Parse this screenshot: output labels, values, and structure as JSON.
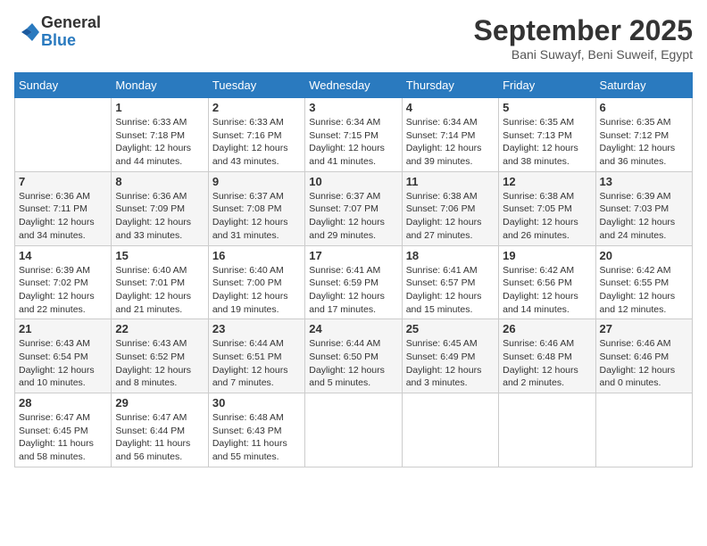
{
  "header": {
    "logo_general": "General",
    "logo_blue": "Blue",
    "month_title": "September 2025",
    "location": "Bani Suwayf, Beni Suweif, Egypt"
  },
  "weekdays": [
    "Sunday",
    "Monday",
    "Tuesday",
    "Wednesday",
    "Thursday",
    "Friday",
    "Saturday"
  ],
  "weeks": [
    [
      {
        "day": "",
        "info": ""
      },
      {
        "day": "1",
        "info": "Sunrise: 6:33 AM\nSunset: 7:18 PM\nDaylight: 12 hours and 44 minutes."
      },
      {
        "day": "2",
        "info": "Sunrise: 6:33 AM\nSunset: 7:16 PM\nDaylight: 12 hours and 43 minutes."
      },
      {
        "day": "3",
        "info": "Sunrise: 6:34 AM\nSunset: 7:15 PM\nDaylight: 12 hours and 41 minutes."
      },
      {
        "day": "4",
        "info": "Sunrise: 6:34 AM\nSunset: 7:14 PM\nDaylight: 12 hours and 39 minutes."
      },
      {
        "day": "5",
        "info": "Sunrise: 6:35 AM\nSunset: 7:13 PM\nDaylight: 12 hours and 38 minutes."
      },
      {
        "day": "6",
        "info": "Sunrise: 6:35 AM\nSunset: 7:12 PM\nDaylight: 12 hours and 36 minutes."
      }
    ],
    [
      {
        "day": "7",
        "info": "Sunrise: 6:36 AM\nSunset: 7:11 PM\nDaylight: 12 hours and 34 minutes."
      },
      {
        "day": "8",
        "info": "Sunrise: 6:36 AM\nSunset: 7:09 PM\nDaylight: 12 hours and 33 minutes."
      },
      {
        "day": "9",
        "info": "Sunrise: 6:37 AM\nSunset: 7:08 PM\nDaylight: 12 hours and 31 minutes."
      },
      {
        "day": "10",
        "info": "Sunrise: 6:37 AM\nSunset: 7:07 PM\nDaylight: 12 hours and 29 minutes."
      },
      {
        "day": "11",
        "info": "Sunrise: 6:38 AM\nSunset: 7:06 PM\nDaylight: 12 hours and 27 minutes."
      },
      {
        "day": "12",
        "info": "Sunrise: 6:38 AM\nSunset: 7:05 PM\nDaylight: 12 hours and 26 minutes."
      },
      {
        "day": "13",
        "info": "Sunrise: 6:39 AM\nSunset: 7:03 PM\nDaylight: 12 hours and 24 minutes."
      }
    ],
    [
      {
        "day": "14",
        "info": "Sunrise: 6:39 AM\nSunset: 7:02 PM\nDaylight: 12 hours and 22 minutes."
      },
      {
        "day": "15",
        "info": "Sunrise: 6:40 AM\nSunset: 7:01 PM\nDaylight: 12 hours and 21 minutes."
      },
      {
        "day": "16",
        "info": "Sunrise: 6:40 AM\nSunset: 7:00 PM\nDaylight: 12 hours and 19 minutes."
      },
      {
        "day": "17",
        "info": "Sunrise: 6:41 AM\nSunset: 6:59 PM\nDaylight: 12 hours and 17 minutes."
      },
      {
        "day": "18",
        "info": "Sunrise: 6:41 AM\nSunset: 6:57 PM\nDaylight: 12 hours and 15 minutes."
      },
      {
        "day": "19",
        "info": "Sunrise: 6:42 AM\nSunset: 6:56 PM\nDaylight: 12 hours and 14 minutes."
      },
      {
        "day": "20",
        "info": "Sunrise: 6:42 AM\nSunset: 6:55 PM\nDaylight: 12 hours and 12 minutes."
      }
    ],
    [
      {
        "day": "21",
        "info": "Sunrise: 6:43 AM\nSunset: 6:54 PM\nDaylight: 12 hours and 10 minutes."
      },
      {
        "day": "22",
        "info": "Sunrise: 6:43 AM\nSunset: 6:52 PM\nDaylight: 12 hours and 8 minutes."
      },
      {
        "day": "23",
        "info": "Sunrise: 6:44 AM\nSunset: 6:51 PM\nDaylight: 12 hours and 7 minutes."
      },
      {
        "day": "24",
        "info": "Sunrise: 6:44 AM\nSunset: 6:50 PM\nDaylight: 12 hours and 5 minutes."
      },
      {
        "day": "25",
        "info": "Sunrise: 6:45 AM\nSunset: 6:49 PM\nDaylight: 12 hours and 3 minutes."
      },
      {
        "day": "26",
        "info": "Sunrise: 6:46 AM\nSunset: 6:48 PM\nDaylight: 12 hours and 2 minutes."
      },
      {
        "day": "27",
        "info": "Sunrise: 6:46 AM\nSunset: 6:46 PM\nDaylight: 12 hours and 0 minutes."
      }
    ],
    [
      {
        "day": "28",
        "info": "Sunrise: 6:47 AM\nSunset: 6:45 PM\nDaylight: 11 hours and 58 minutes."
      },
      {
        "day": "29",
        "info": "Sunrise: 6:47 AM\nSunset: 6:44 PM\nDaylight: 11 hours and 56 minutes."
      },
      {
        "day": "30",
        "info": "Sunrise: 6:48 AM\nSunset: 6:43 PM\nDaylight: 11 hours and 55 minutes."
      },
      {
        "day": "",
        "info": ""
      },
      {
        "day": "",
        "info": ""
      },
      {
        "day": "",
        "info": ""
      },
      {
        "day": "",
        "info": ""
      }
    ]
  ]
}
